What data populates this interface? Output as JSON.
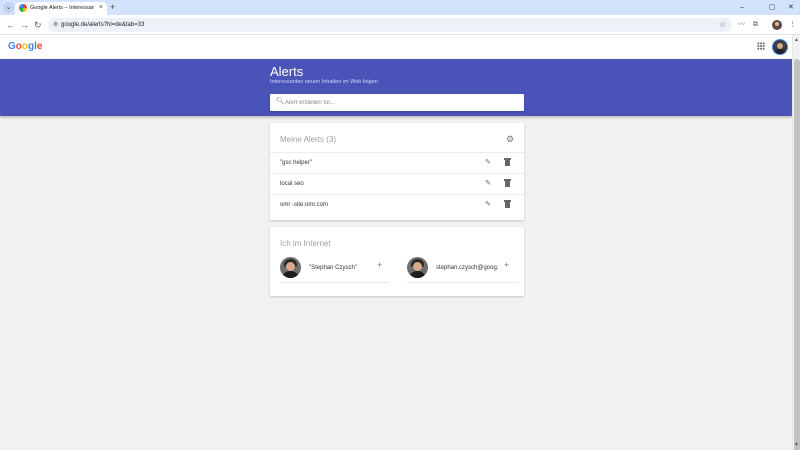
{
  "browser": {
    "tab_title": "Google Alerts – Interessanten n",
    "url": "google.de/alerts?hl=de&tab=33",
    "new_tab": "+",
    "tab_close": "×",
    "tab_list": "⌄",
    "window_controls": [
      "–",
      "▢",
      "✕"
    ]
  },
  "page": {
    "logo": [
      "G",
      "o",
      "o",
      "g",
      "l",
      "e"
    ],
    "banner": {
      "title": "Alerts",
      "subtitle": "Interessanten neuen Inhalten im Web folgen"
    },
    "search": {
      "placeholder": "Alert erstellen für..."
    },
    "alerts_card": {
      "title": "Meine Alerts (3)",
      "items": [
        {
          "label": "\"gsc helper\""
        },
        {
          "label": "local seo"
        },
        {
          "label": "omr -site:omr.com"
        }
      ]
    },
    "internet_card": {
      "title": "Ich im Internet",
      "people": [
        {
          "name": "\"Stephan Czysch\""
        },
        {
          "name": "stephan.czysch@goog..."
        }
      ]
    }
  },
  "colors": {
    "banner": "#4a54b8",
    "tabstrip": "#d3e3fd",
    "background": "#f1f1f1"
  },
  "icons": {
    "search": "search-icon",
    "settings": "gear-icon",
    "edit": "pencil-icon",
    "delete": "trash-icon",
    "add": "plus-icon",
    "apps": "apps-grid-icon"
  }
}
